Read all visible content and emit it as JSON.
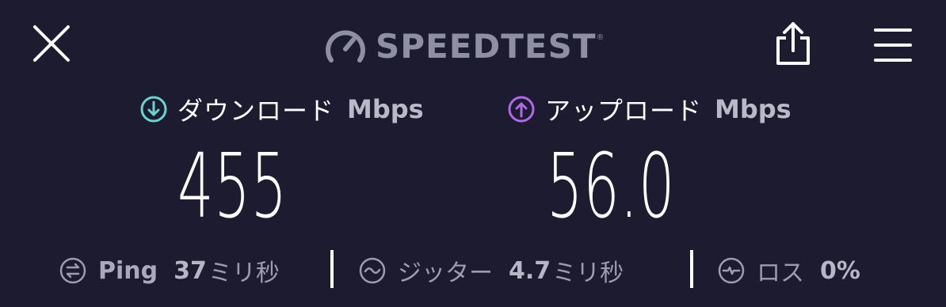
{
  "header": {
    "brand": "SPEEDTEST",
    "trademark": "®",
    "icons": {
      "close": "close-icon",
      "share": "share-icon",
      "menu": "menu-icon",
      "gauge": "speedometer-icon"
    }
  },
  "download": {
    "label": "ダウンロード",
    "unit": "Mbps",
    "value": "455",
    "icon": "download-arrow-icon",
    "color": "#67d6cf"
  },
  "upload": {
    "label": "アップロード",
    "unit": "Mbps",
    "value": "56.0",
    "icon": "upload-arrow-icon",
    "color": "#b068e6"
  },
  "stats": {
    "ping": {
      "label": "Ping",
      "value": "37",
      "unit": "ミリ秒",
      "icon": "ping-icon"
    },
    "jitter": {
      "label": "ジッター",
      "value": "4.7",
      "unit": "ミリ秒",
      "icon": "jitter-icon"
    },
    "loss": {
      "label": "ロス",
      "value": "0%",
      "icon": "packet-loss-icon"
    }
  },
  "colors": {
    "background": "#1c1b30",
    "text": "#ffffff",
    "muted": "#9d9db0"
  }
}
